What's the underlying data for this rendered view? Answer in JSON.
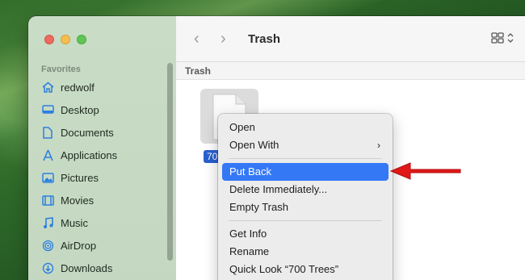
{
  "window": {
    "title": "Trash",
    "path_label": "Trash"
  },
  "sidebar": {
    "heading": "Favorites",
    "items": [
      {
        "label": "redwolf",
        "icon": "home-icon"
      },
      {
        "label": "Desktop",
        "icon": "desktop-icon"
      },
      {
        "label": "Documents",
        "icon": "document-icon"
      },
      {
        "label": "Applications",
        "icon": "applications-icon"
      },
      {
        "label": "Pictures",
        "icon": "pictures-icon"
      },
      {
        "label": "Movies",
        "icon": "movies-icon"
      },
      {
        "label": "Music",
        "icon": "music-icon"
      },
      {
        "label": "AirDrop",
        "icon": "airdrop-icon"
      },
      {
        "label": "Downloads",
        "icon": "downloads-icon"
      }
    ]
  },
  "file": {
    "label": "70"
  },
  "context_menu": {
    "items": [
      {
        "label": "Open"
      },
      {
        "label": "Open With",
        "submenu": "›"
      },
      {
        "label": "Put Back",
        "highlighted": true
      },
      {
        "label": "Delete Immediately..."
      },
      {
        "label": "Empty Trash"
      },
      {
        "label": "Get Info"
      },
      {
        "label": "Rename"
      },
      {
        "label": "Quick Look “700 Trees”"
      }
    ]
  },
  "colors": {
    "highlight": "#3478f6",
    "annotation_arrow": "#e01818",
    "sidebar_icon": "#2b7fe0"
  }
}
